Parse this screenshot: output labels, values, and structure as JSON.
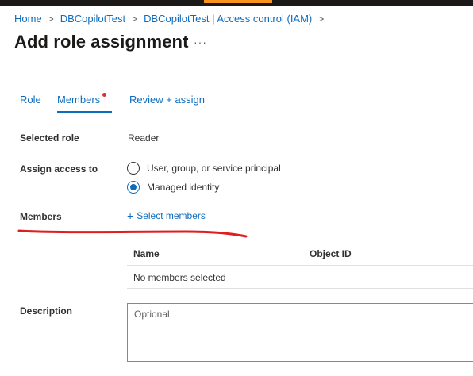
{
  "breadcrumb": {
    "items": [
      "Home",
      "DBCopilotTest",
      "DBCopilotTest | Access control (IAM)"
    ],
    "separator": ">"
  },
  "header": {
    "title": "Add role assignment",
    "more_label": "···"
  },
  "tabs": [
    {
      "label": "Role"
    },
    {
      "label": "Members",
      "active": true,
      "has_indicator": true
    },
    {
      "label": "Review + assign"
    }
  ],
  "form": {
    "selected_role": {
      "label": "Selected role",
      "value": "Reader"
    },
    "assign_access": {
      "label": "Assign access to",
      "options": [
        {
          "label": "User, group, or service principal",
          "checked": false
        },
        {
          "label": "Managed identity",
          "checked": true
        }
      ]
    },
    "members": {
      "label": "Members",
      "select_label": "Select members",
      "table": {
        "columns": [
          "Name",
          "Object ID"
        ],
        "empty_text": "No members selected"
      }
    },
    "description": {
      "label": "Description",
      "placeholder": "Optional"
    }
  },
  "colors": {
    "link": "#0f6cbd",
    "indicator": "#d13438",
    "annotation": "#e01e1e",
    "topbar": "#1b1a19",
    "topbar_accent": "#f7941d"
  }
}
